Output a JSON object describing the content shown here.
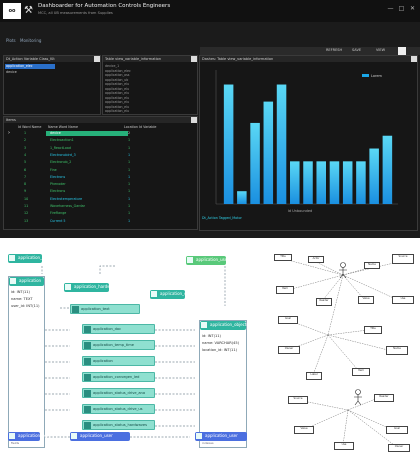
{
  "app": {
    "logo_text": "oo",
    "title": "Dashboarder for Automation Controls Engineers",
    "subtitle": "MCC, all UB measurements from Supplies",
    "menu_tabs": [
      "Plots",
      "Monitoring"
    ],
    "toolbar_buttons": [
      "REFRESH",
      "SAVE",
      "VIEW"
    ],
    "left_top_panel": {
      "title": "Dt_Action Variable Class_Kit",
      "items": [
        "application_elec",
        "device"
      ]
    },
    "middle_top_panel": {
      "title": "Table view_variable_information",
      "items": [
        "device_1",
        "application_elec",
        "application_oss",
        "application_ub",
        "application_elu",
        "application_elu",
        "application_elu",
        "application_elu",
        "application_elu",
        "application_elu",
        "application_elu"
      ]
    },
    "chart_panel": {
      "title": "Dashes: Table view_variable_information",
      "footer": "Dt_Action Tagged_Motor"
    },
    "table": {
      "title": "Items",
      "headers": [
        "Id Word Name",
        "Name Word Name",
        "Location Id Variable"
      ],
      "rows": [
        {
          "id": "1",
          "name": "device",
          "loc": "2"
        },
        {
          "id": "2",
          "name": "Electroaction1",
          "loc": "1"
        },
        {
          "id": "3",
          "name": "1_ReactLoad",
          "loc": "1"
        },
        {
          "id": "4",
          "name": "Electronobird_3",
          "loc": "1"
        },
        {
          "id": "5",
          "name": "Electronob_2",
          "loc": "1"
        },
        {
          "id": "6",
          "name": "Fine",
          "loc": "1"
        },
        {
          "id": "7",
          "name": "Electrons",
          "loc": "1"
        },
        {
          "id": "8",
          "name": "Phenoder",
          "loc": "1"
        },
        {
          "id": "9",
          "name": "Electrons",
          "loc": "1"
        },
        {
          "id": "10",
          "name": "Electrotemperature",
          "loc": "1"
        },
        {
          "id": "11",
          "name": "Waveharness_Gardar",
          "loc": "1"
        },
        {
          "id": "12",
          "name": "FireRange",
          "loc": "1"
        },
        {
          "id": "13",
          "name": "Current 5",
          "loc": "1"
        }
      ]
    }
  },
  "chart_data": {
    "type": "bar",
    "values": [
      28,
      3,
      19,
      24,
      28,
      10,
      10,
      10,
      10,
      10,
      10,
      13,
      16
    ],
    "xlabel": "Id Unbounded",
    "ylim": [
      0,
      30
    ],
    "legend": "Lorem",
    "legend_position": "top-right",
    "grid": false,
    "colors": {
      "bar": "#1aa7e8",
      "bar_light": "#5ad8f5"
    }
  },
  "diagram": {
    "nodes": {
      "application_data": {
        "title": "application_data"
      },
      "application": {
        "title": "application",
        "fields": [
          "id: INT(11)",
          "name: TEXT",
          "user_id: INT(11)"
        ]
      },
      "application_hardware": {
        "title": "application_hardware"
      },
      "application_dist": {
        "title": "application_dist"
      },
      "application_user": {
        "title": "application_user"
      },
      "application_objects": {
        "title": "application_objects",
        "fields": [
          "id: INT(11)",
          "name: VARCHAR(45)",
          "location_id: INT(11)"
        ]
      }
    },
    "pills": [
      "application_text",
      "application_doc",
      "application_temp_time",
      "application",
      "application_convegen_led",
      "application_status_drive_ana",
      "application_status_drive_us",
      "application_status_hardwaves"
    ],
    "mid_pill": "application_pl",
    "footer_items": [
      "application_temp",
      "application_dc",
      "application_main",
      "application_dis"
    ],
    "bottom_nodes": [
      "application_beh",
      "application_user",
      "application_user"
    ],
    "left_footer": "fields",
    "right_footer": "indexes"
  },
  "uml_labels": [
    "Title",
    "Actor",
    "Name",
    "Source",
    "Item",
    "Reader",
    "Value",
    "Use",
    "Goal",
    "Owner",
    "Label"
  ]
}
